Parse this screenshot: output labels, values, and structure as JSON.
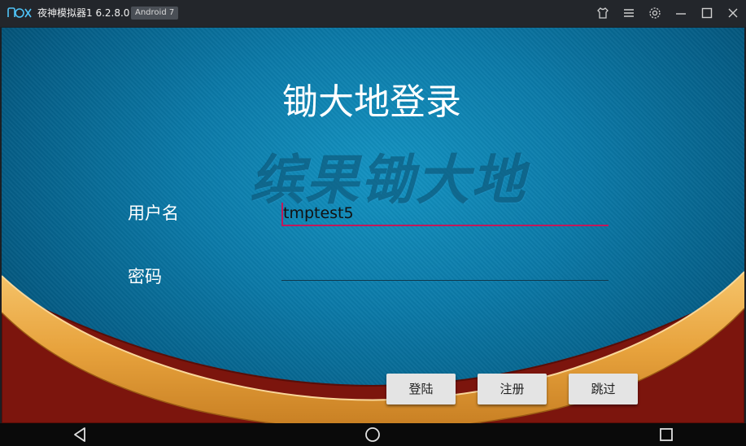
{
  "window": {
    "logo_text": "nox",
    "title": "夜神模拟器1 6.2.8.0",
    "badge": "Android 7",
    "buttons": [
      "theme-icon",
      "menu-icon",
      "settings-icon",
      "minimize-icon",
      "maximize-icon",
      "close-icon"
    ]
  },
  "app": {
    "login_title": "锄大地登录",
    "watermark": "缤果锄大地",
    "username_label": "用户名",
    "username_value": "tmptest5",
    "password_label": "密码",
    "password_value": "",
    "buttons": {
      "login": "登陆",
      "register": "注册",
      "skip": "跳过"
    },
    "colors": {
      "accent": "#c2185b",
      "felt": "#0b7aa8",
      "wood": "#e8a340",
      "rim": "#8a1a10"
    }
  },
  "navbar": {
    "buttons": [
      "back-icon",
      "home-icon",
      "recents-icon"
    ]
  }
}
